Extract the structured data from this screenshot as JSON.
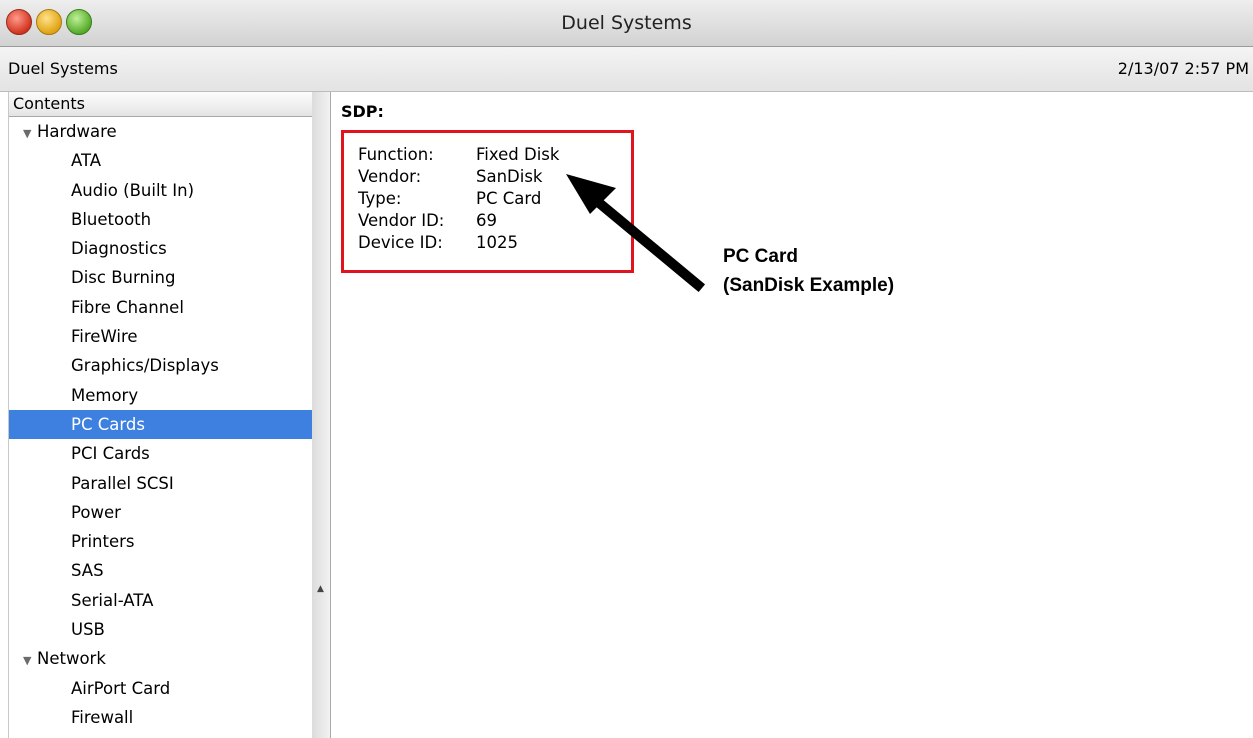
{
  "window": {
    "title": "Duel Systems"
  },
  "info_bar": {
    "name": "Duel Systems",
    "timestamp": "2/13/07 2:57 PM"
  },
  "sidebar": {
    "header": "Contents",
    "groups": [
      {
        "label": "Hardware",
        "expanded": true,
        "items": [
          "ATA",
          "Audio (Built In)",
          "Bluetooth",
          "Diagnostics",
          "Disc Burning",
          "Fibre Channel",
          "FireWire",
          "Graphics/Displays",
          "Memory",
          "PC Cards",
          "PCI Cards",
          "Parallel SCSI",
          "Power",
          "Printers",
          "SAS",
          "Serial-ATA",
          "USB"
        ]
      },
      {
        "label": "Network",
        "expanded": true,
        "items": [
          "AirPort Card",
          "Firewall"
        ]
      }
    ],
    "selected": "PC Cards"
  },
  "detail": {
    "title": "SDP:",
    "rows": [
      {
        "key": "Function:",
        "value": "Fixed Disk"
      },
      {
        "key": "Vendor:",
        "value": "SanDisk"
      },
      {
        "key": "Type:",
        "value": "PC Card"
      },
      {
        "key": "Vendor ID:",
        "value": "69"
      },
      {
        "key": "Device ID:",
        "value": "1025"
      }
    ]
  },
  "annotation": {
    "line1": "PC Card",
    "line2": "(SanDisk Example)"
  },
  "colors": {
    "highlight_box": "#e0141e",
    "selection": "#3d80df",
    "arrow": "#000000"
  }
}
